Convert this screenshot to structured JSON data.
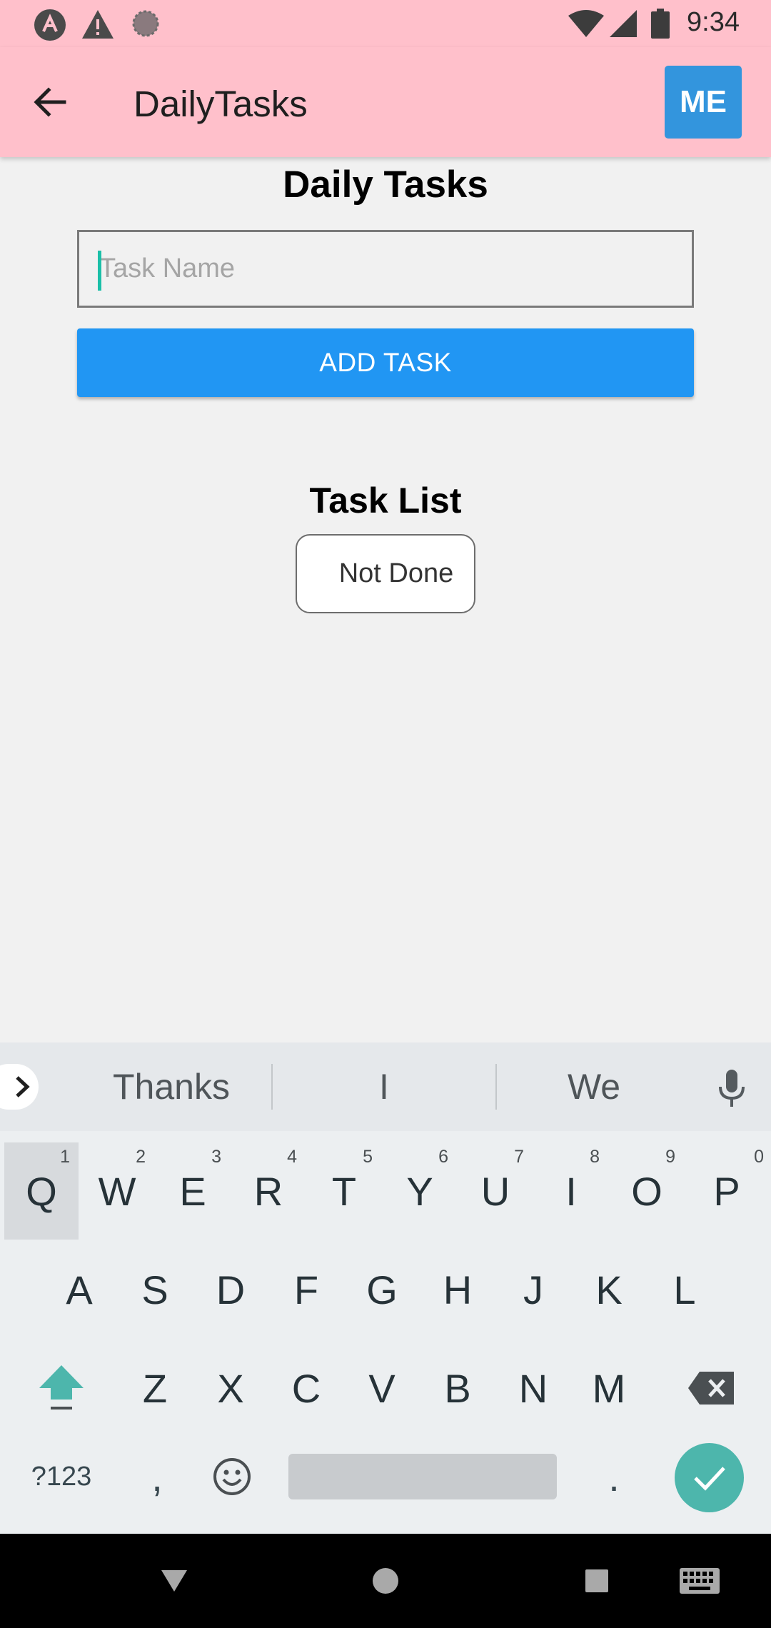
{
  "status_bar": {
    "time": "9:34",
    "icons": [
      "launcher-a-icon",
      "warning-icon",
      "sync-icon",
      "wifi-icon",
      "signal-icon",
      "battery-icon"
    ]
  },
  "app_bar": {
    "title": "DailyTasks",
    "back_icon": "arrow-back-icon",
    "me_label": "ME",
    "background": "#ffc0cb",
    "me_color": "#3395dd"
  },
  "main": {
    "heading": "Daily Tasks",
    "task_input": {
      "placeholder": "Task Name",
      "value": ""
    },
    "add_button_label": "ADD TASK",
    "add_button_color": "#2196f3",
    "task_list_heading": "Task List",
    "filter_button_label": "Not Done"
  },
  "keyboard": {
    "suggestions": [
      "Thanks",
      "I",
      "We"
    ],
    "row1": [
      {
        "key": "Q",
        "hint": "1"
      },
      {
        "key": "W",
        "hint": "2"
      },
      {
        "key": "E",
        "hint": "3"
      },
      {
        "key": "R",
        "hint": "4"
      },
      {
        "key": "T",
        "hint": "5"
      },
      {
        "key": "Y",
        "hint": "6"
      },
      {
        "key": "U",
        "hint": "7"
      },
      {
        "key": "I",
        "hint": "8"
      },
      {
        "key": "O",
        "hint": "9"
      },
      {
        "key": "P",
        "hint": "0"
      }
    ],
    "row2": [
      "A",
      "S",
      "D",
      "F",
      "G",
      "H",
      "J",
      "K",
      "L"
    ],
    "row3": [
      "Z",
      "X",
      "C",
      "V",
      "B",
      "N",
      "M"
    ],
    "row4": {
      "symbols_label": "?123",
      "comma": ",",
      "period": "."
    },
    "accent_color": "#4db6ac"
  },
  "nav_bar": {
    "icons": [
      "back-triangle-icon",
      "home-circle-icon",
      "recents-square-icon",
      "keyboard-icon"
    ]
  }
}
